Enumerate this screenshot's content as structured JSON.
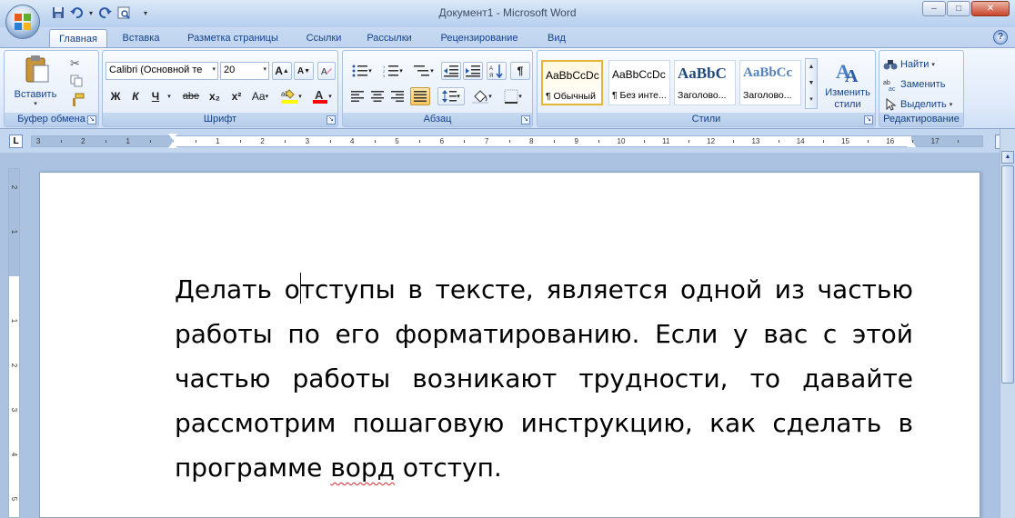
{
  "window": {
    "title": "Документ1 - Microsoft Word",
    "minimize": "–",
    "maximize": "□",
    "close": "✕"
  },
  "qat": {
    "save_icon": "save-icon",
    "undo_icon": "undo-icon",
    "redo_icon": "redo-icon",
    "print_preview_icon": "print-preview-icon"
  },
  "tabs": [
    {
      "label": "Главная"
    },
    {
      "label": "Вставка"
    },
    {
      "label": "Разметка страницы"
    },
    {
      "label": "Ссылки"
    },
    {
      "label": "Рассылки"
    },
    {
      "label": "Рецензирование"
    },
    {
      "label": "Вид"
    }
  ],
  "help": "?",
  "groups": {
    "clipboard": {
      "label": "Буфер обмена",
      "paste": "Вставить"
    },
    "font": {
      "label": "Шрифт",
      "font_name": "Calibri (Основной те",
      "font_size": "20",
      "bold": "Ж",
      "italic": "К",
      "underline": "Ч",
      "strike": "abe",
      "sub": "x₂",
      "sup": "x²",
      "case": "Aa",
      "grow": "A",
      "shrink": "A"
    },
    "paragraph": {
      "label": "Абзац",
      "pilcrow": "¶"
    },
    "styles": {
      "label": "Стили",
      "cards": [
        {
          "sample": "AaBbCcDc",
          "name": "¶ Обычный"
        },
        {
          "sample": "AaBbCcDc",
          "name": "¶ Без инте..."
        },
        {
          "sample": "AaBbC",
          "name": "Заголово..."
        },
        {
          "sample": "AaBbCc",
          "name": "Заголово..."
        }
      ],
      "change_styles": "Изменить стили"
    },
    "editing": {
      "label": "Редактирование",
      "find": "Найти",
      "replace": "Заменить",
      "select": "Выделить"
    }
  },
  "ruler": {
    "h_ticks": [
      "3",
      "2",
      "1",
      "1",
      "2",
      "3",
      "4",
      "5",
      "6",
      "7",
      "8",
      "9",
      "10",
      "11",
      "12",
      "13",
      "14",
      "15",
      "16",
      "17"
    ],
    "v_ticks": [
      "2",
      "1",
      "1",
      "2",
      "3",
      "4",
      "5"
    ]
  },
  "document": {
    "before_caret": "Делать о",
    "after_caret": "тступы в тексте, является одной из частью работы по его форматированию. Если у вас с этой частью работы возникают трудности, то давайте рассмотрим пошаговую инструкцию, как сделать в программе ",
    "misspelled": "ворд",
    "ending": " отступ."
  },
  "colors": {
    "highlight": "#ffff00",
    "font_color": "#ff0000",
    "accent": "#15428b"
  }
}
